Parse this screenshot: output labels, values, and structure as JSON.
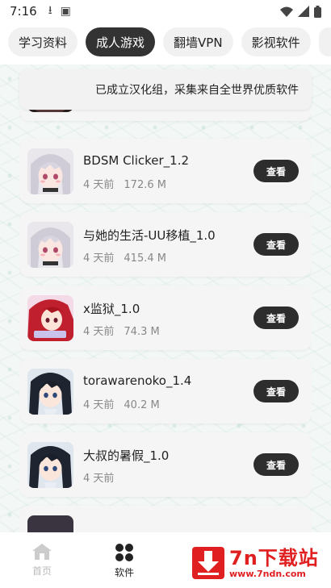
{
  "status_bar": {
    "time": "7:16"
  },
  "tabs": [
    {
      "label": "学习资料",
      "active": false
    },
    {
      "label": "成人游戏",
      "active": true
    },
    {
      "label": "翻墙VPN",
      "active": false
    },
    {
      "label": "影视软件",
      "active": false
    },
    {
      "label": "",
      "active": false
    }
  ],
  "notice": {
    "text": "已成立汉化组，采集来自全世界优质软件"
  },
  "list": {
    "items": [
      {
        "name": "BDSM Clicker_1.2",
        "age": "4 天前",
        "size": "172.6 M",
        "button": "查看",
        "icon": "silver-hair-girl-thumbnail"
      },
      {
        "name": "与她的生活-UU移植_1.0",
        "age": "4 天前",
        "size": "415.4 M",
        "button": "查看",
        "icon": "silver-hair-girl-thumbnail"
      },
      {
        "name": "x监狱_1.0",
        "age": "4 天前",
        "size": "74.3 M",
        "button": "查看",
        "icon": "red-hair-girl-thumbnail"
      },
      {
        "name": "torawarenoko_1.4",
        "age": "4 天前",
        "size": "40.2 M",
        "button": "查看",
        "icon": "dark-hair-girl-thumbnail"
      },
      {
        "name": "大叔的暑假_1.0",
        "age": "4 天前",
        "size": "",
        "button": "查看",
        "icon": "dark-hair-girl-thumbnail"
      }
    ]
  },
  "bottom_nav": {
    "home_label": "首页",
    "software_label": "软件"
  },
  "watermark": {
    "title": "7n下载站",
    "url": "www.7ndn.com"
  },
  "colors": {
    "active_tab": "#333333",
    "button": "#2d2d2d",
    "watermark": "#e02020"
  }
}
